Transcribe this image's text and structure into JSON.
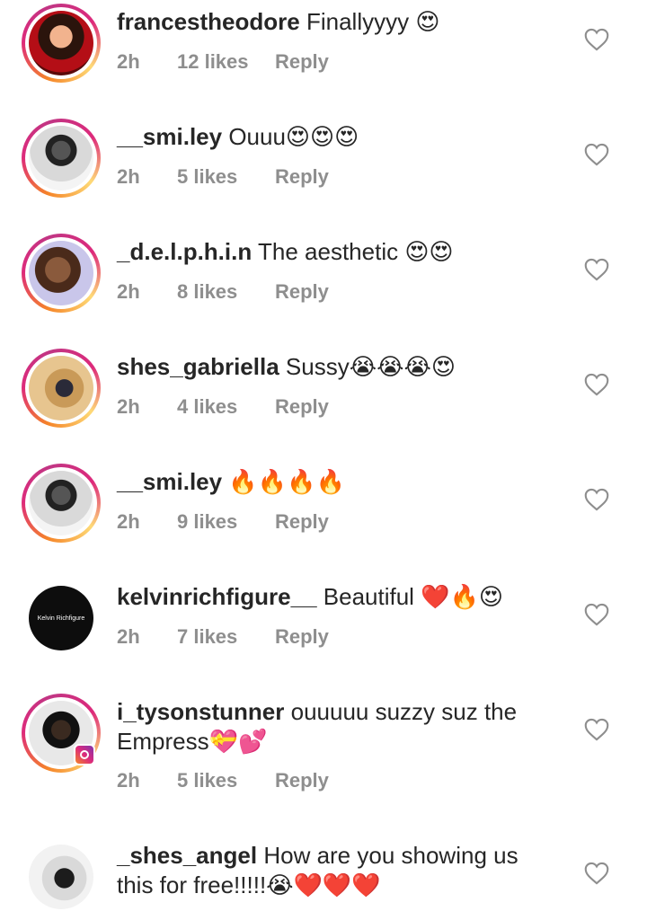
{
  "comments": [
    {
      "username": "francestheodore",
      "text": "Finallyyyy 😍",
      "time": "2h",
      "likes": "12 likes",
      "reply": "Reply",
      "avatar": "profile-photo"
    },
    {
      "username": "__smi.ley",
      "text": "Ouuu😍😍😍",
      "time": "2h",
      "likes": "5 likes",
      "reply": "Reply",
      "avatar": "profile-photo"
    },
    {
      "username": "_d.e.l.p.h.i.n",
      "text": "The aesthetic 😍😍",
      "time": "2h",
      "likes": "8 likes",
      "reply": "Reply",
      "avatar": "profile-photo"
    },
    {
      "username": "shes_gabriella",
      "text": "Sussy😭😭😭😍",
      "time": "2h",
      "likes": "4 likes",
      "reply": "Reply",
      "avatar": "profile-photo"
    },
    {
      "username": "__smi.ley",
      "text": "🔥🔥🔥🔥",
      "time": "2h",
      "likes": "9 likes",
      "reply": "Reply",
      "avatar": "profile-photo"
    },
    {
      "username": "kelvinrichfigure__",
      "text": "Beautiful ❤️🔥😍",
      "time": "2h",
      "likes": "7 likes",
      "reply": "Reply",
      "avatar": "logo",
      "avatar_text": "Kelvin Richfigure"
    },
    {
      "username": "i_tysonstunner",
      "text": "ouuuuu suzzy suz the Empress💝💕",
      "time": "2h",
      "likes": "5 likes",
      "reply": "Reply",
      "avatar": "profile-photo"
    },
    {
      "username": "_shes_angel",
      "text": "How are you showing us this for free!!!!!😭❤️❤️❤️",
      "time": "",
      "likes": "",
      "reply": "",
      "avatar": "profile-photo"
    }
  ],
  "icons": {
    "like": "heart-outline-icon",
    "badge": "instagram-icon"
  },
  "colors": {
    "meta": "#8e8e8e",
    "text": "#262626",
    "ring_start": "#f58529",
    "ring_end": "#dd2a7b"
  }
}
